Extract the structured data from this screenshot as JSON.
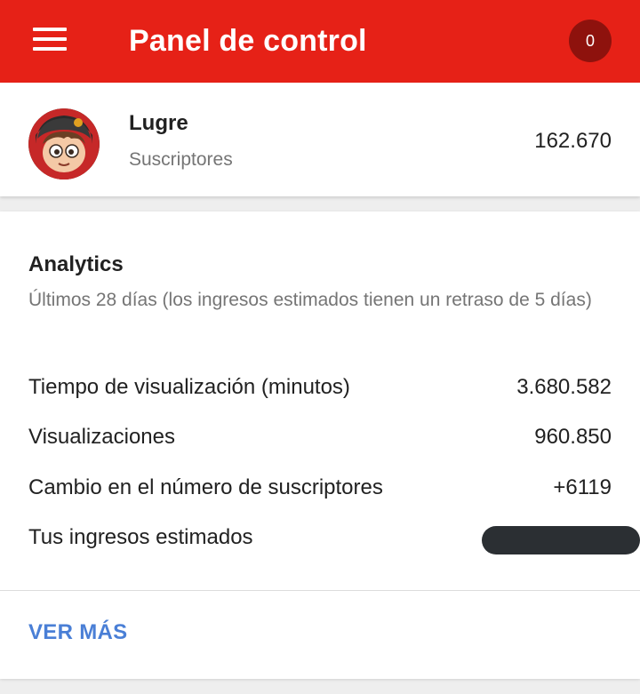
{
  "app_bar": {
    "title": "Panel de control",
    "notification_count": "0",
    "colors": {
      "background": "#e62117",
      "badge": "#8e120d"
    }
  },
  "channel": {
    "name": "Lugre",
    "subscribers_label": "Suscriptores",
    "subscribers_count": "162.670"
  },
  "analytics": {
    "title": "Analytics",
    "subtitle": "Últimos 28 días (los ingresos estimados tienen un retraso de 5 días)",
    "stats": [
      {
        "label": "Tiempo de visualización (minutos)",
        "value": "3.680.582"
      },
      {
        "label": "Visualizaciones",
        "value": "960.850"
      },
      {
        "label": "Cambio en el número de suscriptores",
        "value": "+6119"
      },
      {
        "label": "Tus ingresos estimados",
        "value": ""
      }
    ],
    "see_more": "VER MÁS",
    "link_color": "#4a7fd6"
  }
}
